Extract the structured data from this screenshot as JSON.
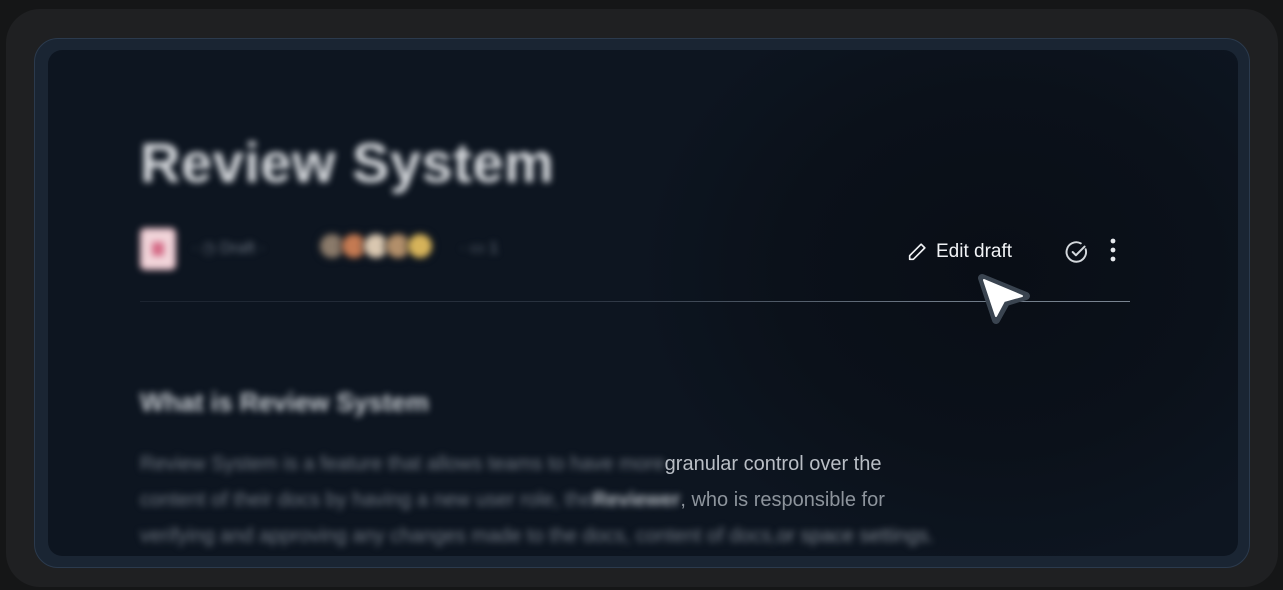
{
  "page": {
    "title": "Review System",
    "section_heading": "What is Review System"
  },
  "meta": {
    "info_text": "· ◷ Draft ·",
    "count_text": "· ▭ 1"
  },
  "toolbar": {
    "edit_label": "Edit draft",
    "icons": [
      "pencil-icon",
      "check-circle-icon",
      "more-vertical-icon"
    ]
  },
  "body": {
    "line1_blur": "Review System is a feature that allows teams to have more ",
    "line1_clear": "granular control over the",
    "line2_blur_a": "content of their docs by having a new user role, the ",
    "line2_bold": "Reviewer",
    "line2_clear": ", who is responsible for",
    "line3_blur": "verifying and approving any changes made to the docs, content of docs, ",
    "line3_clear": "or space settings."
  },
  "colors": {
    "background": "#151617",
    "card": "#0b111a",
    "accent_text": "#f1f3f6",
    "doc_icon": "#f1d5da"
  }
}
